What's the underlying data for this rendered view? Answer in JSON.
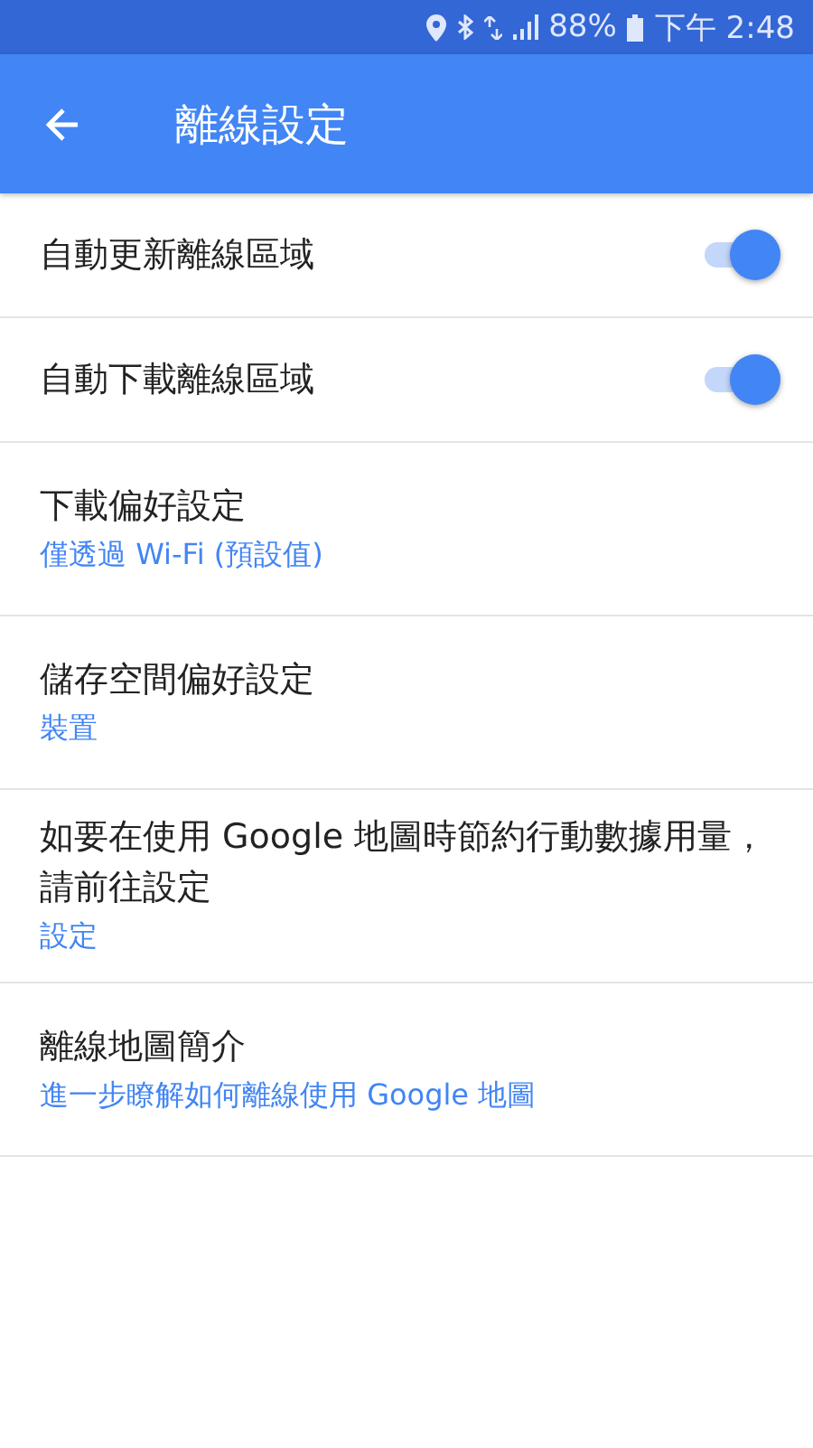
{
  "status_bar": {
    "battery": "88%",
    "time": "下午 2:48"
  },
  "app_bar": {
    "title": "離線設定"
  },
  "settings": [
    {
      "kind": "toggle",
      "title": "自動更新離線區域",
      "on": true
    },
    {
      "kind": "toggle",
      "title": "自動下載離線區域",
      "on": true
    },
    {
      "kind": "link",
      "title": "下載偏好設定",
      "subtitle": "僅透過 Wi-Fi (預設值)"
    },
    {
      "kind": "link",
      "title": "儲存空間偏好設定",
      "subtitle": "裝置"
    },
    {
      "kind": "link",
      "title": "如要在使用 Google 地圖時節約行動數據用量，請前往設定",
      "subtitle": "設定"
    },
    {
      "kind": "link",
      "title": "離線地圖簡介",
      "subtitle": "進一步瞭解如何離線使用 Google 地圖"
    }
  ]
}
